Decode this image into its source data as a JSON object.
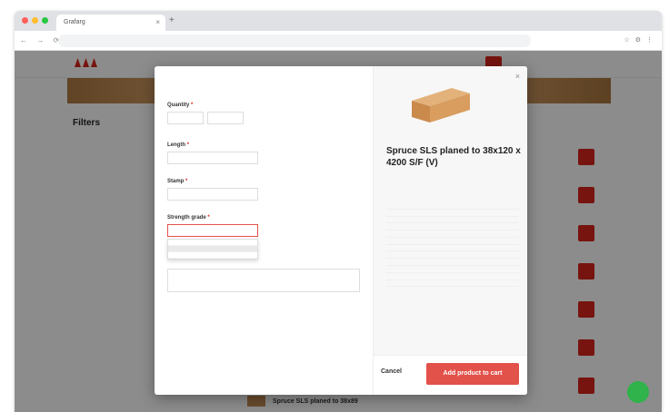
{
  "browser": {
    "tab_title": "Grafarg",
    "address": "",
    "new_tab_symbol": "+",
    "tab_close_symbol": "×",
    "nav_symbols": "← → ⟳",
    "ext_symbols": "☆ ⚙ ⋮",
    "dot_colors": [
      "#ff5f57",
      "#febc2e",
      "#28c840"
    ]
  },
  "site": {
    "breadcrumbs": "",
    "breadcrumb_accent": "",
    "account": "",
    "brand_color": "#d9261c",
    "green_color": "#3a8a3a"
  },
  "filters": {
    "heading": "Filters",
    "sections": []
  },
  "listing": {
    "sort_label": "",
    "bottom_item": "Spruce SLS planed to 38x89"
  },
  "modal": {
    "title": "",
    "quantity": {
      "label": "Quantity",
      "required": "*",
      "value": "",
      "unit": ""
    },
    "units": [],
    "length": {
      "label": "Length",
      "required": "*",
      "value": "",
      "link": ""
    },
    "stamp": {
      "label": "Stamp",
      "required": "*",
      "value": ""
    },
    "strength": {
      "label": "Strength grade",
      "required": "*",
      "placeholder": "",
      "options": [
        "",
        "",
        ""
      ],
      "selected_index": 1
    },
    "notes_label": "",
    "footer_note": "",
    "footer_link": ""
  },
  "product": {
    "close_symbol": "×",
    "name": "Spruce SLS planed to 38x120 x 4200 S/F (V)",
    "sku": "",
    "specs_heading": "",
    "specs": [
      {
        "k": "",
        "v": ""
      },
      {
        "k": "",
        "v": ""
      },
      {
        "k": "",
        "v": ""
      },
      {
        "k": "",
        "v": ""
      },
      {
        "k": "",
        "v": ""
      },
      {
        "k": "",
        "v": ""
      },
      {
        "k": "",
        "v": ""
      },
      {
        "k": "",
        "v": ""
      },
      {
        "k": "",
        "v": ""
      },
      {
        "k": "",
        "v": ""
      },
      {
        "k": "",
        "v": ""
      },
      {
        "k": "",
        "v": ""
      }
    ],
    "cancel": "Cancel",
    "add_button": "Add product to cart"
  }
}
